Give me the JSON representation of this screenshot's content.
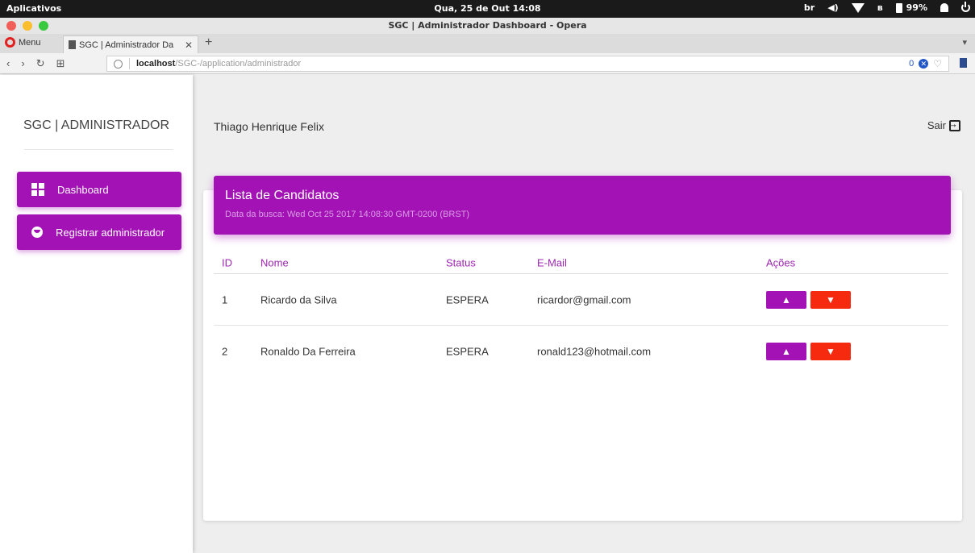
{
  "os": {
    "apps_label": "Aplicativos",
    "datetime": "Qua, 25 de Out  14:08",
    "keyboard": "br",
    "battery": "99%"
  },
  "window": {
    "title": "SGC | Administrador Dashboard - Opera",
    "colors": {
      "close": "#f25f58",
      "minimize": "#fbbe2e",
      "maximize": "#39c93f"
    }
  },
  "browser": {
    "menu_label": "Menu",
    "tab_title": "SGC | Administrador Da",
    "url_host": "localhost",
    "url_path": "/SGC-/application/administrador",
    "adblock_count": "0"
  },
  "sidebar": {
    "brand": "SGC | ADMINISTRADOR",
    "items": [
      {
        "label": "Dashboard",
        "icon": "dashboard-icon"
      },
      {
        "label": "Registrar administrador",
        "icon": "face-icon"
      }
    ]
  },
  "header": {
    "user_name": "Thiago Henrique Felix",
    "logout_label": "Sair"
  },
  "card": {
    "title": "Lista de Candidatos",
    "subtitle": "Data da busca: Wed Oct 25 2017 14:08:30 GMT-0200 (BRST)"
  },
  "table": {
    "columns": [
      "ID",
      "Nome",
      "Status",
      "E-Mail",
      "Ações"
    ],
    "rows": [
      {
        "id": "1",
        "name": "Ricardo da Silva",
        "status": "ESPERA",
        "email": "ricardor@gmail.com"
      },
      {
        "id": "2",
        "name": "Ronaldo Da Ferreira",
        "status": "ESPERA",
        "email": "ronald123@hotmail.com"
      }
    ]
  },
  "theme": {
    "accent": "#a312b5",
    "danger": "#f52a0f"
  }
}
